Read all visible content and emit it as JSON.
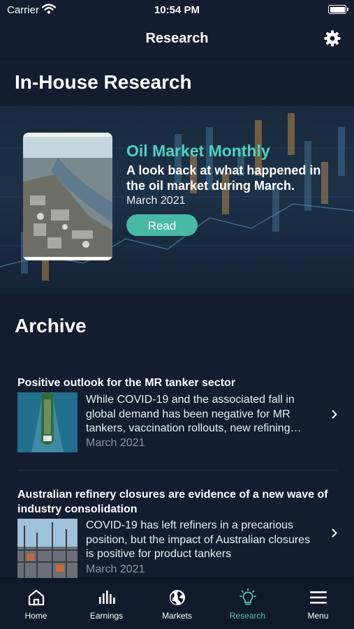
{
  "status": {
    "carrier": "Carrier",
    "time": "10:54 PM"
  },
  "nav": {
    "title": "Research"
  },
  "sections": {
    "inhouse": "In-House Research",
    "archive": "Archive"
  },
  "hero": {
    "kicker": "Oil Market Monthly",
    "description": "A look back at what happened in the oil market during March.",
    "date": "March 2021",
    "button": "Read"
  },
  "archive": [
    {
      "title": "Positive outlook for the MR tanker sector",
      "excerpt": "While COVID-19 and the associated fall in global demand has been negative for MR tankers, vaccination rollouts, new refining…",
      "date": "March 2021"
    },
    {
      "title": "Australian refinery closures are evidence of a new wave of industry consolidation",
      "excerpt": "COVID-19 has left refiners in a precarious position, but the impact of Australian closures is positive for product tankers",
      "date": "March 2021"
    }
  ],
  "tabs": [
    {
      "label": "Home",
      "icon": "home-icon"
    },
    {
      "label": "Earnings",
      "icon": "bar-chart-icon"
    },
    {
      "label": "Markets",
      "icon": "globe-icon"
    },
    {
      "label": "Research",
      "icon": "lightbulb-icon",
      "active": true
    },
    {
      "label": "Menu",
      "icon": "hamburger-menu-icon"
    }
  ],
  "colors": {
    "background": "#131d2f",
    "accent": "#4ed1bd",
    "button": "#47b9a5",
    "active_tab": "#4ec2ad"
  }
}
